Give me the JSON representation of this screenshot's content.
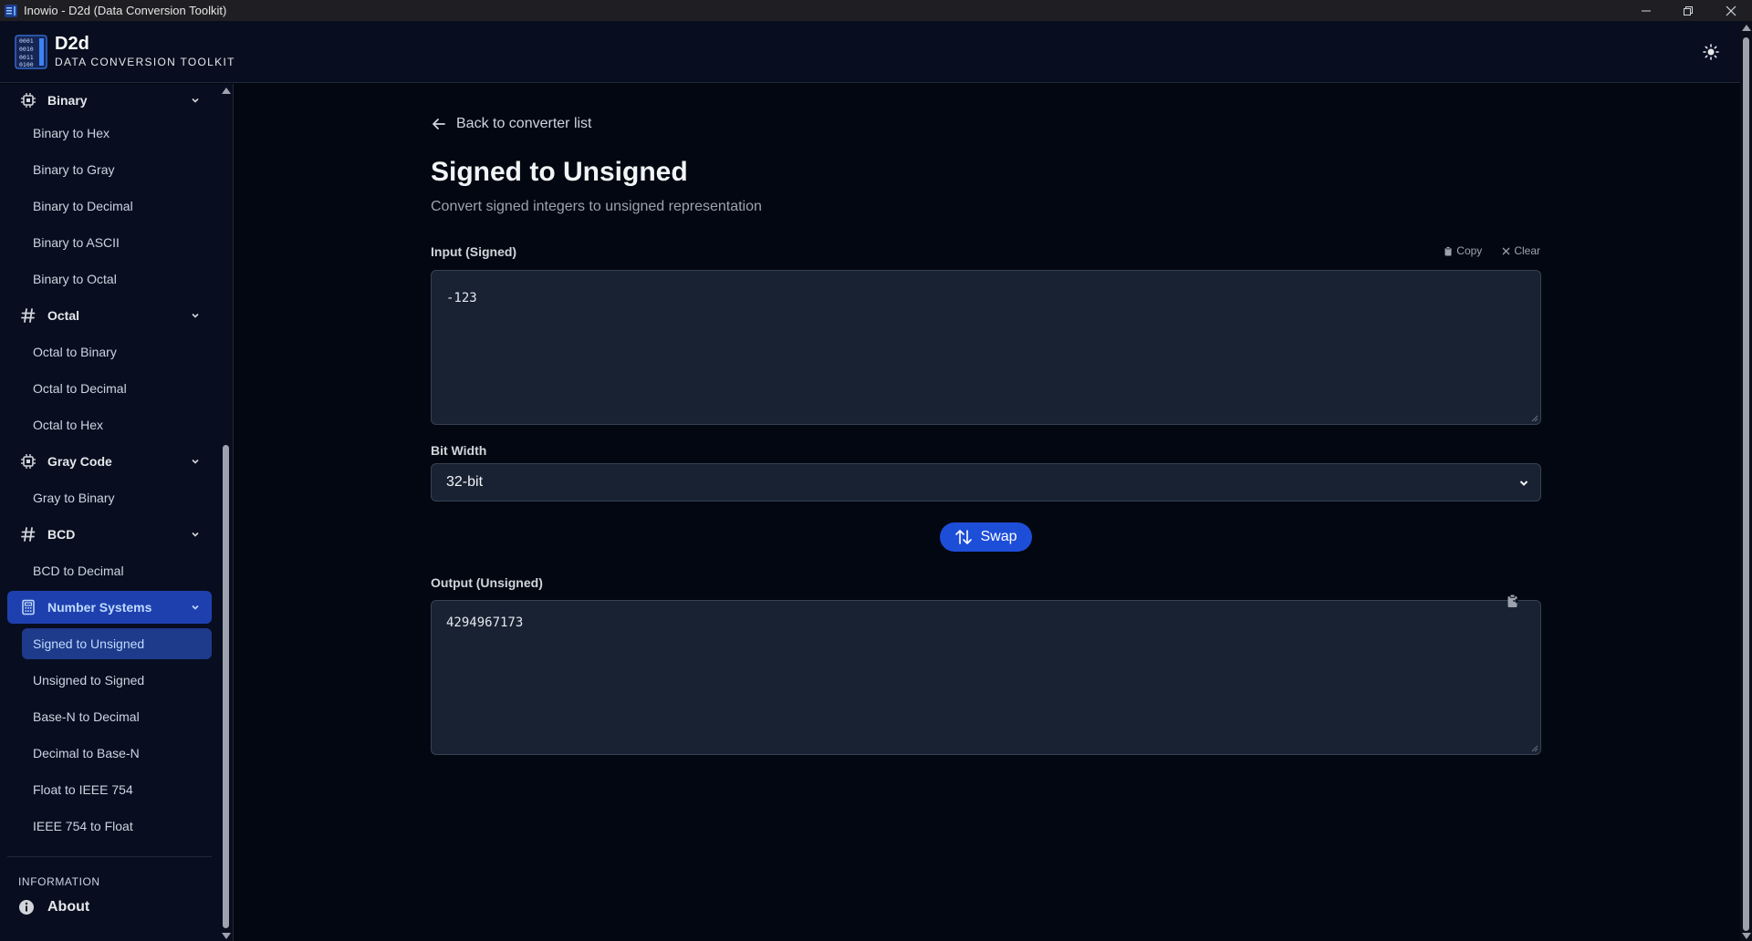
{
  "window": {
    "title": "Inowio - D2d (Data Conversion Toolkit)"
  },
  "header": {
    "brand_name": "D2d",
    "brand_sub": "DATA CONVERSION TOOLKIT",
    "logo_lines": [
      "0001",
      "0010",
      "0011",
      "0100"
    ]
  },
  "sidebar": {
    "categories": {
      "binary": {
        "label": "Binary",
        "items": [
          "Binary to Hex",
          "Binary to Gray",
          "Binary to Decimal",
          "Binary to ASCII",
          "Binary to Octal"
        ]
      },
      "octal": {
        "label": "Octal",
        "items": [
          "Octal to Binary",
          "Octal to Decimal",
          "Octal to Hex"
        ]
      },
      "gray": {
        "label": "Gray Code",
        "items": [
          "Gray to Binary"
        ]
      },
      "bcd": {
        "label": "BCD",
        "items": [
          "BCD to Decimal"
        ]
      },
      "number_systems": {
        "label": "Number Systems",
        "items": [
          "Signed to Unsigned",
          "Unsigned to Signed",
          "Base-N to Decimal",
          "Decimal to Base-N",
          "Float to IEEE 754",
          "IEEE 754 to Float"
        ]
      }
    },
    "info_section": "INFORMATION",
    "about": "About"
  },
  "main": {
    "back": "Back to converter list",
    "title": "Signed to Unsigned",
    "description": "Convert signed integers to unsigned representation",
    "input": {
      "label": "Input (Signed)",
      "value": "-123",
      "copy": "Copy",
      "clear": "Clear"
    },
    "bit_width": {
      "label": "Bit Width",
      "selected": "32-bit"
    },
    "swap": "Swap",
    "output": {
      "label": "Output (Unsigned)",
      "value": "4294967173"
    }
  },
  "colors": {
    "accent": "#1d4ed8",
    "active_bg": "#1e3a8a",
    "background": "#030712",
    "panel": "#182233"
  }
}
